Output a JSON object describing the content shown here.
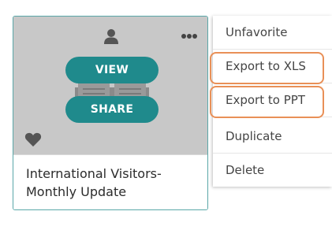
{
  "card": {
    "title": "International Visitors-Monthly Update",
    "view_label": "VIEW",
    "share_label": "SHARE",
    "icons": [
      "user-icon",
      "more-icon",
      "heart-icon"
    ],
    "favorited": true
  },
  "menu": {
    "items": [
      {
        "label": "Unfavorite"
      },
      {
        "label": "Export to XLS"
      },
      {
        "label": "Export to PPT"
      },
      {
        "label": "Duplicate"
      },
      {
        "label": "Delete"
      }
    ],
    "highlighted": [
      "Export to XLS",
      "Export to PPT"
    ]
  },
  "colors": {
    "accent": "#1f8a8c",
    "card_border": "#5aa7a8",
    "thumbnail_bg": "#c8c8c8",
    "highlight": "#e99057",
    "icon": "#555555"
  }
}
